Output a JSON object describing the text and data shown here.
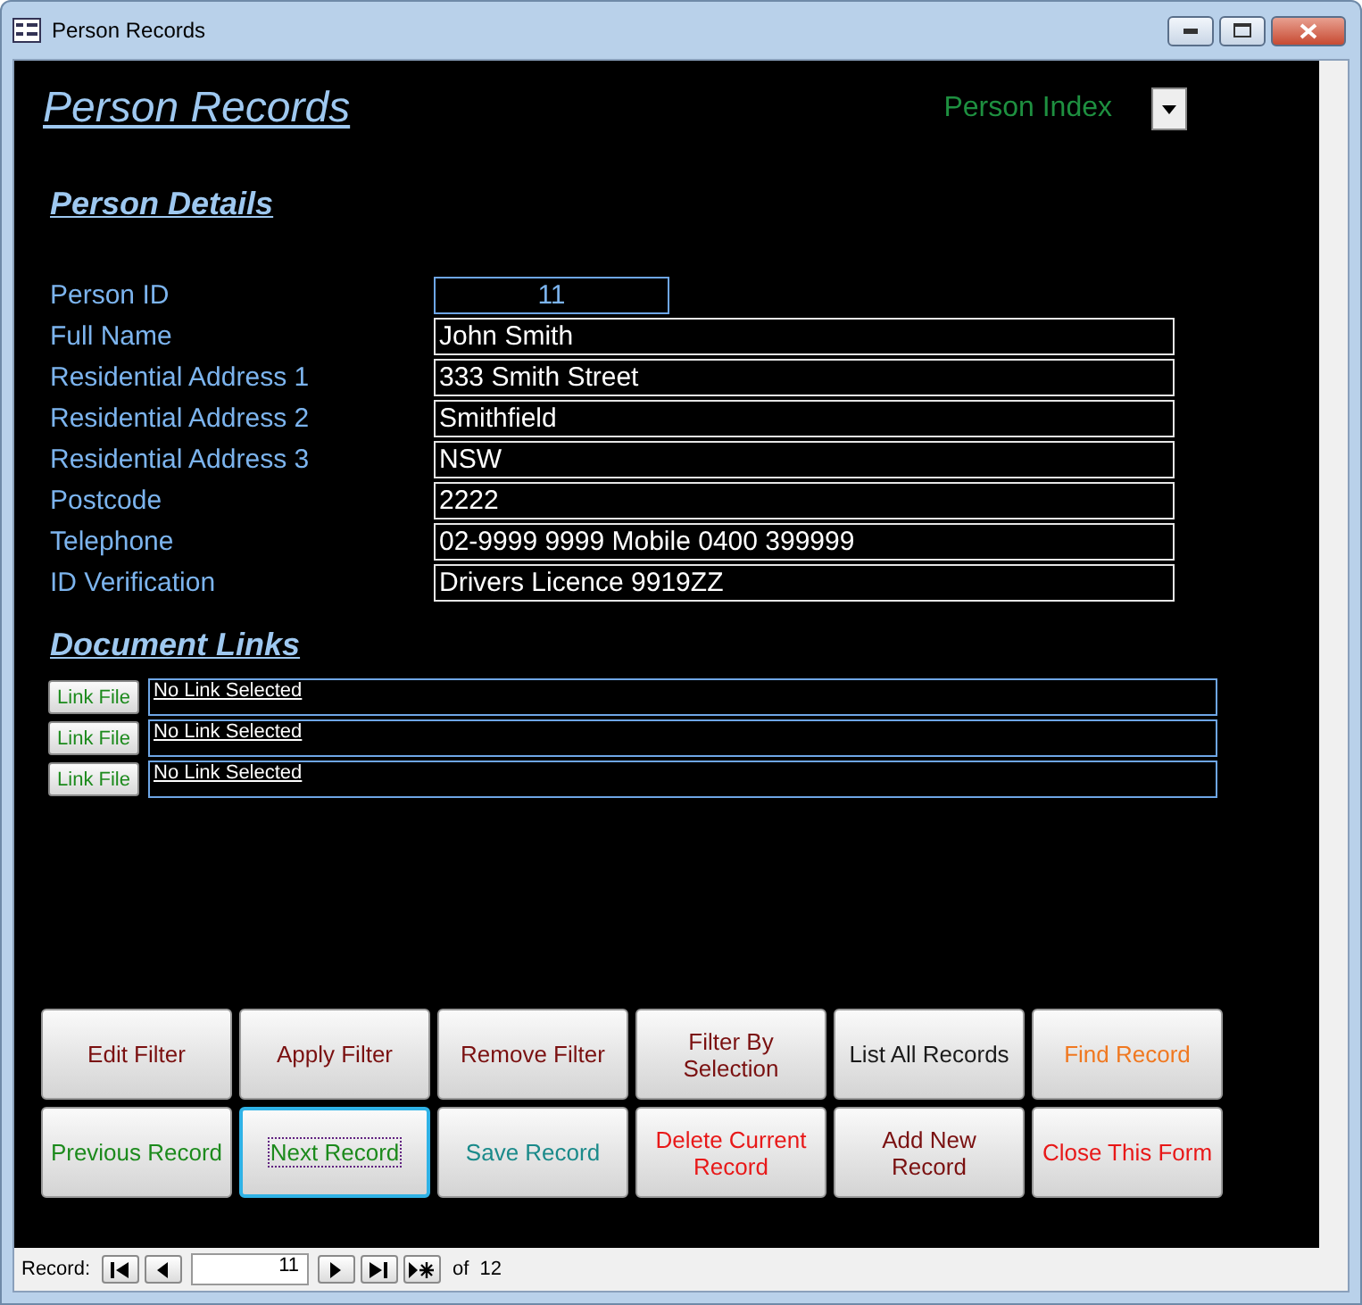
{
  "window": {
    "title": "Person Records"
  },
  "header": {
    "title": "Person Records",
    "index_label": "Person Index"
  },
  "details": {
    "heading": "Person Details",
    "fields": [
      {
        "label": "Person ID",
        "value": "11",
        "kind": "id"
      },
      {
        "label": "Full Name",
        "value": "John Smith",
        "kind": "text"
      },
      {
        "label": "Residential Address 1",
        "value": "333 Smith Street",
        "kind": "text"
      },
      {
        "label": "Residential Address 2",
        "value": "Smithfield",
        "kind": "text"
      },
      {
        "label": "Residential Address 3",
        "value": "NSW",
        "kind": "text"
      },
      {
        "label": "Postcode",
        "value": "2222",
        "kind": "text"
      },
      {
        "label": "Telephone",
        "value": "02-9999 9999 Mobile 0400 399999",
        "kind": "text"
      },
      {
        "label": "ID Verification",
        "value": "Drivers Licence 9919ZZ",
        "kind": "text"
      }
    ]
  },
  "documents": {
    "heading": "Document Links",
    "links": [
      {
        "button": "Link File",
        "link": "No Link Selected"
      },
      {
        "button": "Link File",
        "link": "No Link Selected"
      },
      {
        "button": "Link File",
        "link": "No Link Selected"
      }
    ]
  },
  "buttons": [
    {
      "label": "Edit Filter",
      "color": "#7a1010",
      "selected": false
    },
    {
      "label": "Apply Filter",
      "color": "#7a1010",
      "selected": false
    },
    {
      "label": "Remove Filter",
      "color": "#7a1010",
      "selected": false
    },
    {
      "label": "Filter By Selection",
      "color": "#7a1010",
      "selected": false
    },
    {
      "label": "List All Records",
      "color": "#1a1a1a",
      "selected": false
    },
    {
      "label": "Find Record",
      "color": "#f07820",
      "selected": false
    },
    {
      "label": "Previous Record",
      "color": "#1c8a1c",
      "selected": false
    },
    {
      "label": "Next Record",
      "color": "#1c8a1c",
      "selected": true
    },
    {
      "label": "Save Record",
      "color": "#1a8a8a",
      "selected": false
    },
    {
      "label": "Delete Current Record",
      "color": "#e81818",
      "selected": false
    },
    {
      "label": "Add New Record",
      "color": "#7a1010",
      "selected": false
    },
    {
      "label": "Close This Form",
      "color": "#e81818",
      "selected": false
    }
  ],
  "navigation": {
    "label": "Record:",
    "current": "11",
    "of": "of",
    "total": "12"
  }
}
